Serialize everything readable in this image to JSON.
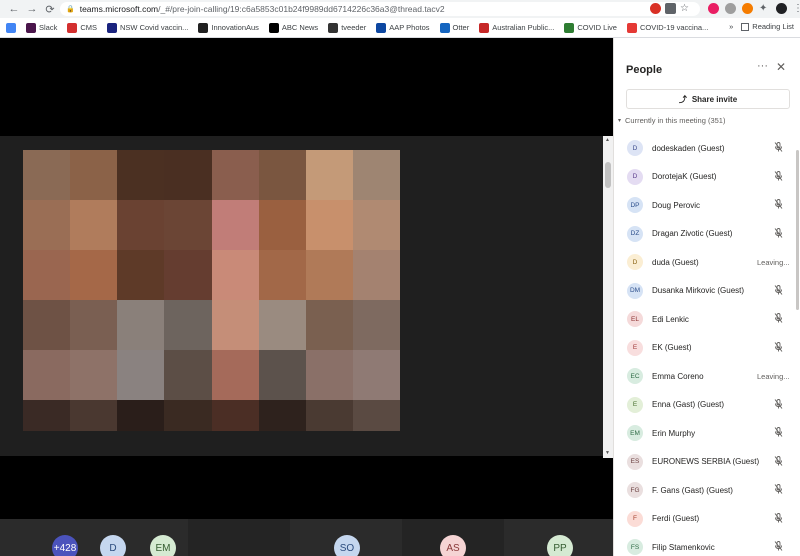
{
  "browser": {
    "url_host": "teams.microsoft.com",
    "url_path": "/_#/pre-join-calling/19:c6a5853c01b24f9989dd6714226c36a3@thread.tacv2",
    "bookmarks": [
      {
        "label": "Slack",
        "color": "#4a154b"
      },
      {
        "label": "CMS",
        "color": "#d32f2f"
      },
      {
        "label": "NSW Covid vaccin...",
        "color": "#1a237e"
      },
      {
        "label": "InnovationAus",
        "color": "#212121"
      },
      {
        "label": "ABC News",
        "color": "#000000"
      },
      {
        "label": "tveeder",
        "color": "#333333"
      },
      {
        "label": "AAP Photos",
        "color": "#0d47a1"
      },
      {
        "label": "Otter",
        "color": "#1565c0"
      },
      {
        "label": "Australian Public...",
        "color": "#c62828"
      },
      {
        "label": "COVID Live",
        "color": "#2e7d32"
      },
      {
        "label": "COVID-19 vaccina...",
        "color": "#e53935"
      }
    ],
    "more_bookmarks": "»",
    "reading_list": "Reading List"
  },
  "participants_strip": [
    {
      "initials": "+428",
      "bg": "#4b53bc",
      "fg": "#ffffff"
    },
    {
      "initials": "D",
      "bg": "#c5d7ef",
      "fg": "#2b4c7e"
    },
    {
      "initials": "EM",
      "bg": "#d5ead2",
      "fg": "#345c30"
    },
    {
      "initials": "SO",
      "bg": "#c5d7ef",
      "fg": "#2b4c7e"
    },
    {
      "initials": "AS",
      "bg": "#f5d4d4",
      "fg": "#8a3a3a"
    },
    {
      "initials": "PP",
      "bg": "#d5ead2",
      "fg": "#345c30"
    }
  ],
  "panel": {
    "title": "People",
    "more": "···",
    "close": "✕",
    "share_label": "Share invite",
    "section_label": "Currently in this meeting (351)",
    "people": [
      {
        "initials": "D",
        "name": "dodeskaden (Guest)",
        "bg": "#dde4f5",
        "fg": "#3b4a8c",
        "status": ""
      },
      {
        "initials": "D",
        "name": "DorotejaK (Guest)",
        "bg": "#e4dcf2",
        "fg": "#5b3d8c",
        "status": ""
      },
      {
        "initials": "DP",
        "name": "Doug Perovic",
        "bg": "#d6e3f5",
        "fg": "#2d4f8c",
        "status": ""
      },
      {
        "initials": "DZ",
        "name": "Dragan Zivotic (Guest)",
        "bg": "#d6e3f5",
        "fg": "#2d4f8c",
        "status": ""
      },
      {
        "initials": "D",
        "name": "duda (Guest)",
        "bg": "#fbeed3",
        "fg": "#8a6414",
        "status": "Leaving..."
      },
      {
        "initials": "DM",
        "name": "Dusanka Mirkovic (Guest)",
        "bg": "#d6e3f5",
        "fg": "#2d4f8c",
        "status": ""
      },
      {
        "initials": "EL",
        "name": "Edi Lenkic",
        "bg": "#f5dada",
        "fg": "#8c3030",
        "status": ""
      },
      {
        "initials": "E",
        "name": "EK (Guest)",
        "bg": "#f8dede",
        "fg": "#a03a3a",
        "status": ""
      },
      {
        "initials": "EC",
        "name": "Emma Coreno",
        "bg": "#d8ece0",
        "fg": "#2e6b45",
        "status": "Leaving..."
      },
      {
        "initials": "E",
        "name": "Enna (Gast) (Guest)",
        "bg": "#e3efd8",
        "fg": "#4a7030",
        "status": ""
      },
      {
        "initials": "EM",
        "name": "Erin Murphy",
        "bg": "#d8ece0",
        "fg": "#2e6b45",
        "status": ""
      },
      {
        "initials": "ES",
        "name": "EURONEWS SERBIA (Guest)",
        "bg": "#eadfdf",
        "fg": "#6b4040",
        "status": ""
      },
      {
        "initials": "FG",
        "name": "F. Gans (Gast) (Guest)",
        "bg": "#eadfdf",
        "fg": "#6b4040",
        "status": ""
      },
      {
        "initials": "F",
        "name": "Ferdi (Guest)",
        "bg": "#fbdcd6",
        "fg": "#a3402d",
        "status": ""
      },
      {
        "initials": "FS",
        "name": "Filip Stamenkovic",
        "bg": "#d8ece0",
        "fg": "#2e6b45",
        "status": ""
      }
    ]
  },
  "video_pixels": [
    [
      "#8a6a55",
      "#8b6248",
      "#4b3022",
      "#4a2f22",
      "#8a5e4e",
      "#7a5640",
      "#c49a78",
      "#9e8572"
    ],
    [
      "#9a6e55",
      "#b07c5c",
      "#6a4232",
      "#6b4535",
      "#c17d78",
      "#9a6040",
      "#c8906c",
      "#b08a72"
    ],
    [
      "#9a6650",
      "#a56848",
      "#5e3a28",
      "#653d30",
      "#c98a78",
      "#a26848",
      "#b07a58",
      "#a48270"
    ],
    [
      "#6e5245",
      "#7a5f52",
      "#8a807a",
      "#6d645e",
      "#c58e78",
      "#9a8b80",
      "#7a6050",
      "#7e6a60"
    ],
    [
      "#8a6a60",
      "#8e7268",
      "#8a8280",
      "#5c4e46",
      "#a56a5a",
      "#5c524c",
      "#8a7068",
      "#8f7a74"
    ],
    [
      "#3a2a25",
      "#4a3830",
      "#2a1e1a",
      "#3a2a22",
      "#4b2e25",
      "#2e221d",
      "#4a3a32",
      "#5a4a42"
    ]
  ]
}
